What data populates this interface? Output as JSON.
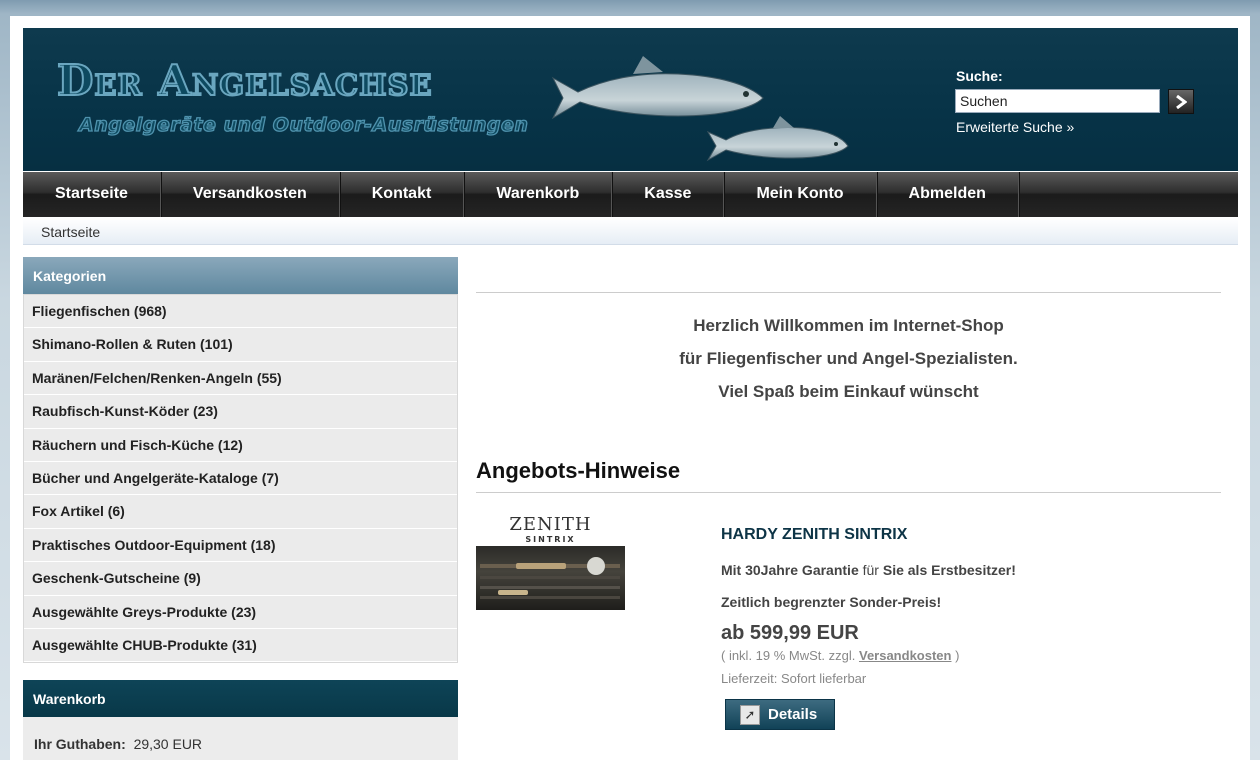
{
  "header": {
    "logo_title": "Der Angelsachse",
    "logo_subtitle": "Angelgeräte und Outdoor-Ausrüstungen",
    "search_label": "Suche:",
    "search_value": "Suchen",
    "advanced_search": "Erweiterte Suche »"
  },
  "nav": [
    "Startseite",
    "Versandkosten",
    "Kontakt",
    "Warenkorb",
    "Kasse",
    "Mein Konto",
    "Abmelden"
  ],
  "breadcrumb": "Startseite",
  "categories": {
    "title": "Kategorien",
    "items": [
      "Fliegenfischen (968)",
      "Shimano-Rollen & Ruten (101)",
      "Maränen/Felchen/Renken-Angeln (55)",
      "Raubfisch-Kunst-Köder (23)",
      "Räuchern und Fisch-Küche (12)",
      "Bücher und Angelgeräte-Kataloge (7)",
      "Fox Artikel (6)",
      "Praktisches Outdoor-Equipment (18)",
      "Geschenk-Gutscheine (9)",
      "Ausgewählte Greys-Produkte (23)",
      "Ausgewählte CHUB-Produkte (31)"
    ]
  },
  "cart": {
    "title": "Warenkorb",
    "balance_label": "Ihr Guthaben:",
    "balance_value": "29,30 EUR"
  },
  "welcome": {
    "line1": "Herzlich Willkommen im Internet-Shop",
    "line2": "für Fliegenfischer und Angel-Spezialisten.",
    "line3": "Viel Spaß beim Einkauf wünscht"
  },
  "offers": {
    "title": "Angebots-Hinweise",
    "product": {
      "image_brand": "ZENITH",
      "image_sub": "SINTRIX",
      "name": "HARDY ZENITH SINTRIX",
      "guarantee_a": "Mit 30Jahre Garantie",
      "guarantee_b": " für ",
      "guarantee_c": "Sie als Erstbesitzer!",
      "special": "Zeitlich begrenzter Sonder-Preis!",
      "price": "ab 599,99 EUR",
      "tax_prefix": "( inkl. 19 % MwSt. zzgl. ",
      "tax_link": "Versandkosten",
      "tax_suffix": " )",
      "delivery": "Lieferzeit: Sofort lieferbar",
      "details_label": "Details"
    }
  },
  "colors": {
    "header_bg": "#073347",
    "nav_bg": "#252525",
    "category_head": "#6f93a8",
    "cart_head": "#0a3c4e"
  }
}
